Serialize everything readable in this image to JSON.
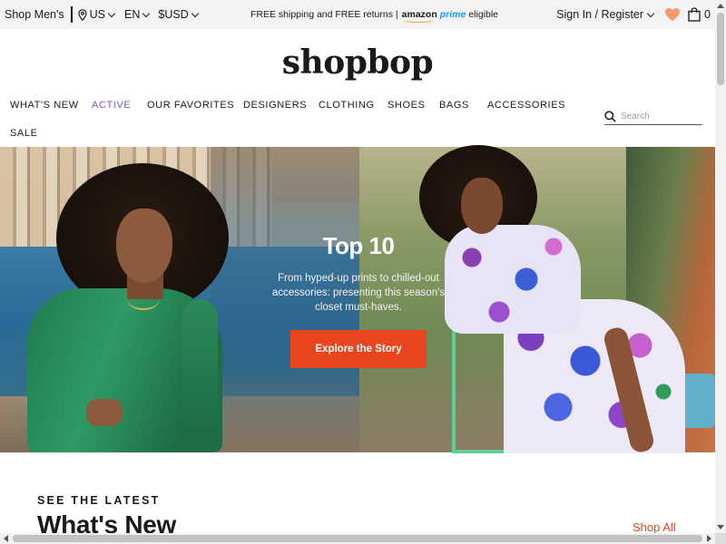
{
  "topbar": {
    "shop_mens": "Shop Men's",
    "country": "US",
    "language": "EN",
    "currency": "$USD",
    "promo_text": "FREE shipping and FREE returns |",
    "amazon_word": "amazon",
    "prime_word": "prime",
    "eligible": "eligible",
    "sign_in": "Sign In / Register",
    "bag_count": "0",
    "heart_color": "#f39a6b"
  },
  "logo": "shopbop",
  "nav": {
    "items": [
      {
        "label": "WHAT'S NEW"
      },
      {
        "label": "ACTIVE"
      },
      {
        "label": "OUR FAVORITES"
      },
      {
        "label": "DESIGNERS"
      },
      {
        "label": "CLOTHING"
      },
      {
        "label": "SHOES"
      },
      {
        "label": "BAGS"
      },
      {
        "label": "ACCESSORIES"
      },
      {
        "label": "SALE"
      }
    ],
    "active_color": "#7a5ac8"
  },
  "search": {
    "placeholder": "Search"
  },
  "hero": {
    "title": "Top 10",
    "subtitle": "From hyped-up prints to chilled-out accessories: presenting this season's closet must-haves.",
    "cta": "Explore the Story",
    "cta_color": "#e8461f"
  },
  "section": {
    "eyebrow": "SEE THE LATEST",
    "title": "What's New",
    "shop_all": "Shop All",
    "link_color": "#e8461f"
  }
}
